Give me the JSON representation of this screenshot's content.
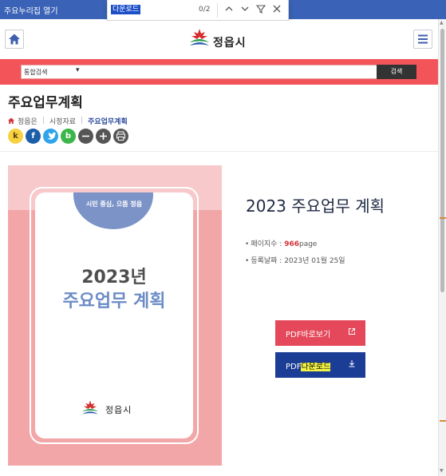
{
  "window": {
    "title": "주요누리집 열기"
  },
  "find": {
    "query": "다운로드",
    "count": "0/2"
  },
  "header": {
    "logo_text": "정읍시"
  },
  "search": {
    "select_value": "통합검색",
    "button_label": "검색"
  },
  "page": {
    "title": "주요업무계획",
    "breadcrumb": [
      "정읍은",
      "시정자료",
      "주요업무계획"
    ]
  },
  "share": {
    "kakao": "k",
    "facebook": "f",
    "band": "b"
  },
  "cover": {
    "slogan": "시민 중심, 으뜸 정읍",
    "year_text": "2023년",
    "plan_text": "주요업무 계획",
    "logo_text": "정읍시"
  },
  "document": {
    "title": "2023 주요업무 계획",
    "pages_label": "페이지수 : ",
    "pages_value": "966",
    "pages_unit": "page",
    "date_label": "등록날짜 : ",
    "date_value": "2023년 01월 25일"
  },
  "buttons": {
    "view_label": "PDF바로보기",
    "download_prefix": "PDF",
    "download_highlight": "다운로드"
  },
  "icons": {
    "home": "home-icon",
    "menu": "hamburger-menu-icon",
    "find_up": "chevron-up-icon",
    "find_down": "chevron-down-icon",
    "find_filter": "filter-icon",
    "find_close": "close-icon",
    "external": "external-link-icon",
    "download": "download-icon"
  },
  "colors": {
    "titlebar": "#3a62b6",
    "search_band": "#f2545a",
    "view_button": "#e4485a",
    "download_button": "#1c3d96",
    "highlight": "#f2f244",
    "accent_red": "#d5333a"
  }
}
